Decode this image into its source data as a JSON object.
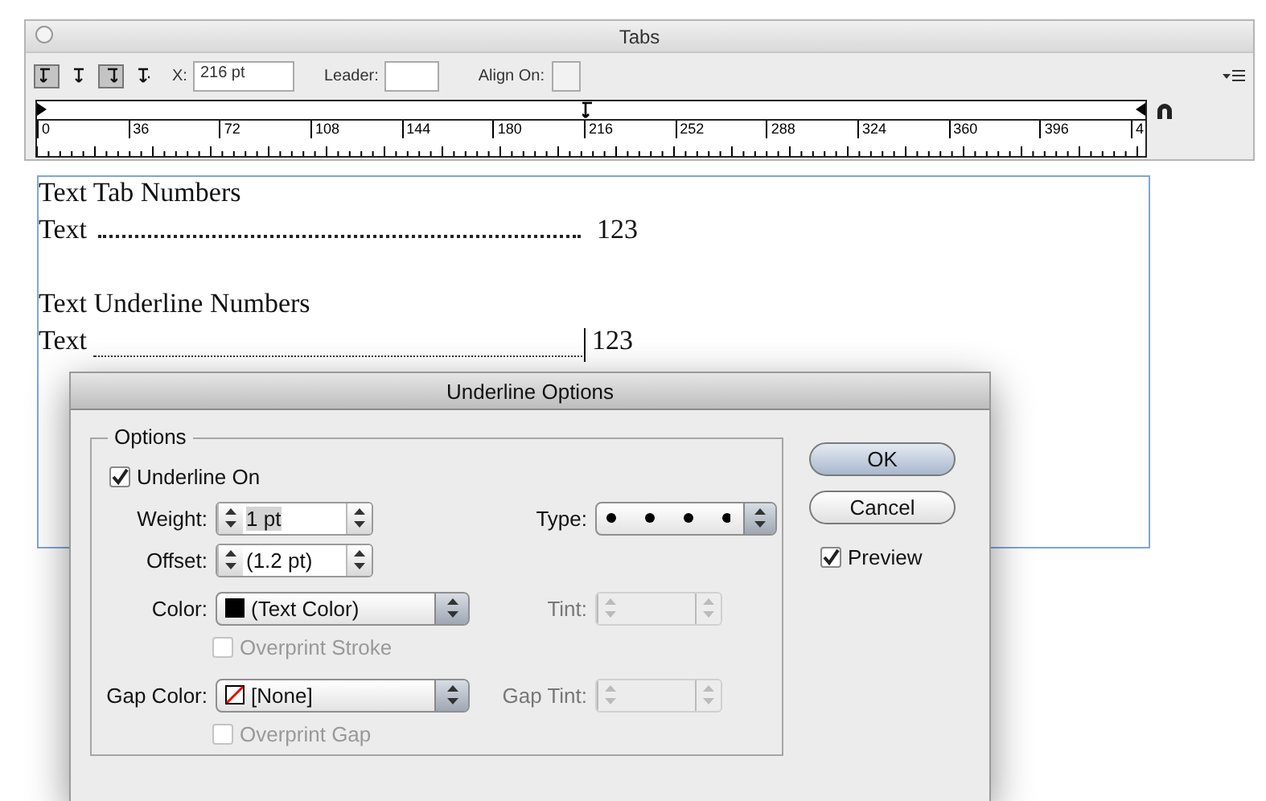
{
  "tabs_panel": {
    "title": "Tabs",
    "alignment_buttons": [
      {
        "selected": true
      },
      {
        "selected": false
      },
      {
        "selected": true
      },
      {
        "selected": false
      }
    ],
    "x_label": "X:",
    "x_value": "216 pt",
    "leader_label": "Leader:",
    "align_on_label": "Align On:",
    "ruler_labels": [
      "0",
      "36",
      "72",
      "108",
      "144",
      "180",
      "216",
      "252",
      "288",
      "324",
      "360",
      "396",
      "4"
    ]
  },
  "document": {
    "lines": [
      {
        "kind": "heading",
        "text": "Text Tab Numbers"
      },
      {
        "kind": "leader",
        "label": "Text",
        "number": "123"
      },
      {
        "kind": "blank"
      },
      {
        "kind": "heading",
        "text": "Text Underline Numbers"
      },
      {
        "kind": "underline",
        "label": "Text",
        "number": "123"
      }
    ]
  },
  "dialog": {
    "title": "Underline Options",
    "group_label": "Options",
    "underline_on": {
      "label": "Underline On",
      "checked": true
    },
    "weight": {
      "label": "Weight:",
      "value": "1 pt"
    },
    "offset": {
      "label": "Offset:",
      "value": "(1.2 pt)"
    },
    "type_label": "Type:",
    "color": {
      "label": "Color:",
      "value": "(Text Color)"
    },
    "tint": {
      "label": "Tint:",
      "disabled": true
    },
    "overprint_stroke": {
      "label": "Overprint Stroke",
      "checked": false,
      "disabled": true
    },
    "gap_color": {
      "label": "Gap Color:",
      "value": "[None]"
    },
    "gap_tint": {
      "label": "Gap Tint:",
      "disabled": true
    },
    "overprint_gap": {
      "label": "Overprint Gap",
      "checked": false,
      "disabled": true
    },
    "buttons": [
      {
        "label": "OK",
        "default": true
      },
      {
        "label": "Cancel",
        "default": false
      }
    ],
    "preview": {
      "label": "Preview",
      "checked": true
    }
  }
}
